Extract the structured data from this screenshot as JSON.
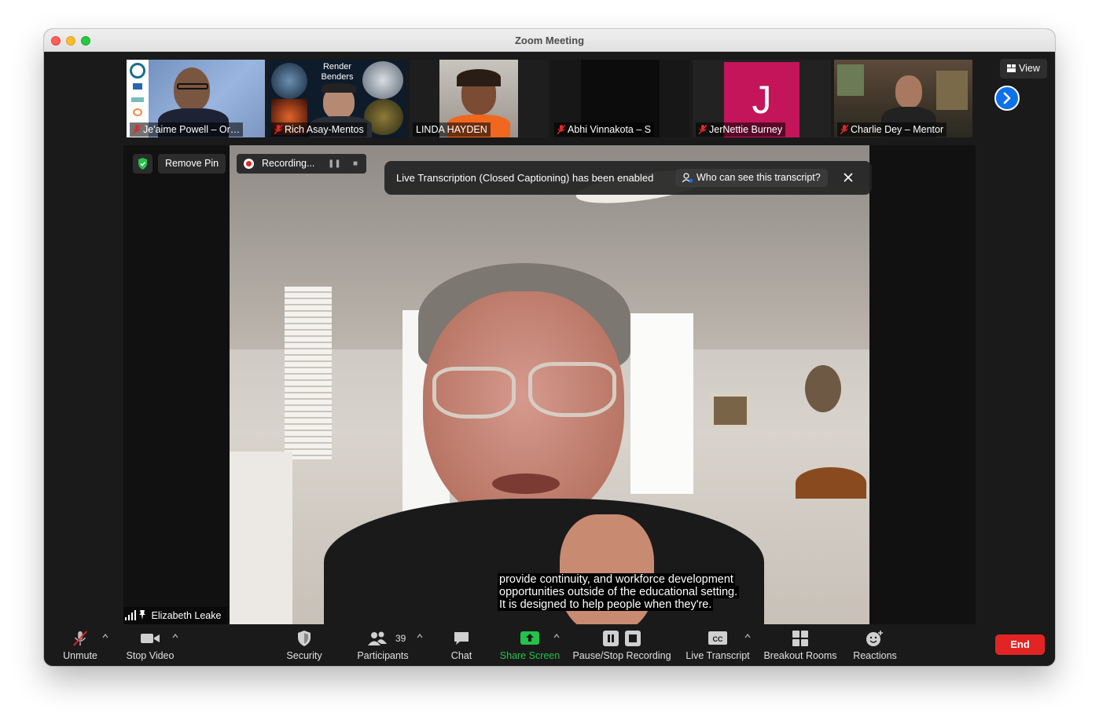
{
  "window": {
    "title": "Zoom Meeting"
  },
  "gallery": {
    "participants": [
      {
        "name": "Je'aime Powell – Or…",
        "muted": true
      },
      {
        "name": "Rich Asay-Mentos",
        "muted": true,
        "overlay_text": "Render Benders"
      },
      {
        "name": "LINDA HAYDEN",
        "muted": false
      },
      {
        "name": "Abhi Vinnakota – S",
        "muted": true
      },
      {
        "name": "JerNettie Burney",
        "muted": true,
        "avatar_letter": "J"
      },
      {
        "name": "Charlie Dey – Mentor",
        "muted": true
      }
    ],
    "view_label": "View"
  },
  "stage": {
    "remove_pin_label": "Remove Pin",
    "recording_label": "Recording...",
    "banner": {
      "text": "Live Transcription (Closed Captioning) has been enabled",
      "who_label": "Who can see this transcript?"
    },
    "captions": [
      "provide continuity, and workforce development",
      "opportunities outside of the educational setting.",
      "It is designed to help people when they're."
    ],
    "active_speaker": "Elizabeth Leake"
  },
  "toolbar": {
    "unmute": "Unmute",
    "stop_video": "Stop Video",
    "security": "Security",
    "participants": "Participants",
    "participant_count": "39",
    "chat": "Chat",
    "share_screen": "Share Screen",
    "pause_stop_recording": "Pause/Stop Recording",
    "live_transcript": "Live Transcript",
    "breakout_rooms": "Breakout Rooms",
    "reactions": "Reactions",
    "end": "End"
  },
  "colors": {
    "accent_blue": "#0e71eb",
    "share_green": "#24c24a",
    "end_red": "#e22424",
    "avatar_magenta": "#c4145a",
    "mute_red": "#e02828"
  }
}
